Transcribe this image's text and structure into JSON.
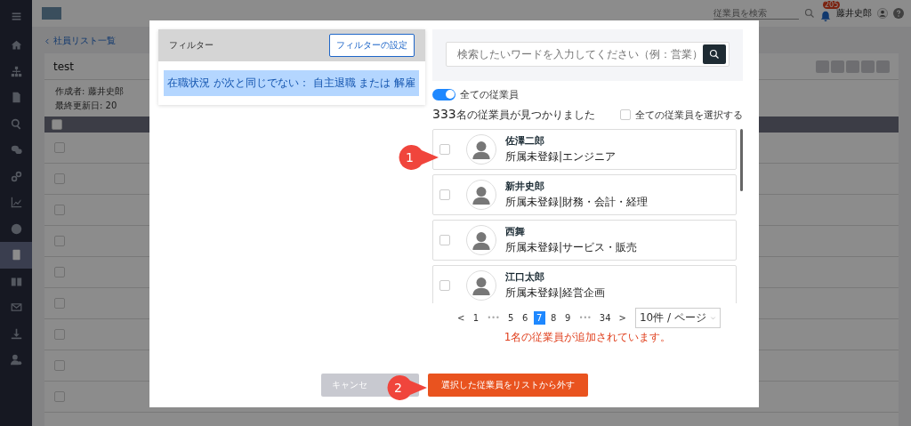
{
  "sidebar": {
    "items": [
      {
        "selected": false
      },
      {
        "selected": false
      },
      {
        "selected": false
      },
      {
        "selected": false
      },
      {
        "selected": false
      },
      {
        "selected": false
      },
      {
        "selected": false
      },
      {
        "selected": false
      },
      {
        "selected": true
      },
      {
        "selected": false
      },
      {
        "selected": false
      },
      {
        "selected": false
      },
      {
        "selected": false
      }
    ]
  },
  "topbar": {
    "search_placeholder": "従業員を検索",
    "notification_count": "205",
    "user_name": "藤井史郎"
  },
  "page": {
    "breadcrumb": "社員リスト一覧",
    "title": "test",
    "author": "作成者: 藤井史郎",
    "updated": "最終更新日: 20",
    "header_checked": false,
    "rows": [
      {
        "checked": false
      },
      {
        "checked": false
      },
      {
        "checked": false
      },
      {
        "checked": false
      },
      {
        "checked": false
      },
      {
        "checked": false
      },
      {
        "checked": false
      },
      {
        "checked": false
      },
      {
        "checked": false
      }
    ]
  },
  "modal": {
    "filter": {
      "title": "フィルター",
      "button": "フィルターの設定",
      "condition": "在職状況 が次と同じでない： 自主退職 または 解雇"
    },
    "search": {
      "placeholder": "検索したいワードを入力してください（例：営業）"
    },
    "toggle": {
      "label": "全ての従業員",
      "on": true
    },
    "result_count": "333",
    "result_text": "名の従業員が見つかりました",
    "select_all": {
      "label": "全ての従業員を選択する",
      "checked": false
    },
    "employees": [
      {
        "name": "佐澤二郎",
        "department": "所属未登録|エンジニア",
        "checked": false
      },
      {
        "name": "新井史郎",
        "department": "所属未登録|財務・会計・経理",
        "checked": false
      },
      {
        "name": "西舞",
        "department": "所属未登録|サービス・販売",
        "checked": false
      },
      {
        "name": "江口太郎",
        "department": "所属未登録|経営企画",
        "checked": false
      }
    ],
    "pagination": {
      "prev": "<",
      "next": ">",
      "page_size": "10件 / ページ",
      "pages": [
        {
          "kind": "page",
          "label": "1",
          "selected": false
        },
        {
          "kind": "ellipsis",
          "label": "•••"
        },
        {
          "kind": "page",
          "label": "5",
          "selected": false
        },
        {
          "kind": "page",
          "label": "6",
          "selected": false
        },
        {
          "kind": "page",
          "label": "7",
          "selected": true
        },
        {
          "kind": "page",
          "label": "8",
          "selected": false
        },
        {
          "kind": "page",
          "label": "9",
          "selected": false
        },
        {
          "kind": "ellipsis",
          "label": "•••"
        },
        {
          "kind": "page",
          "label": "34",
          "selected": false
        }
      ]
    },
    "notice": "1名の従業員が追加されています。",
    "cancel_button": "キャンセ",
    "primary_button": "選択した従業員をリストから外す"
  },
  "callouts": [
    {
      "label": "1"
    },
    {
      "label": "2"
    }
  ]
}
